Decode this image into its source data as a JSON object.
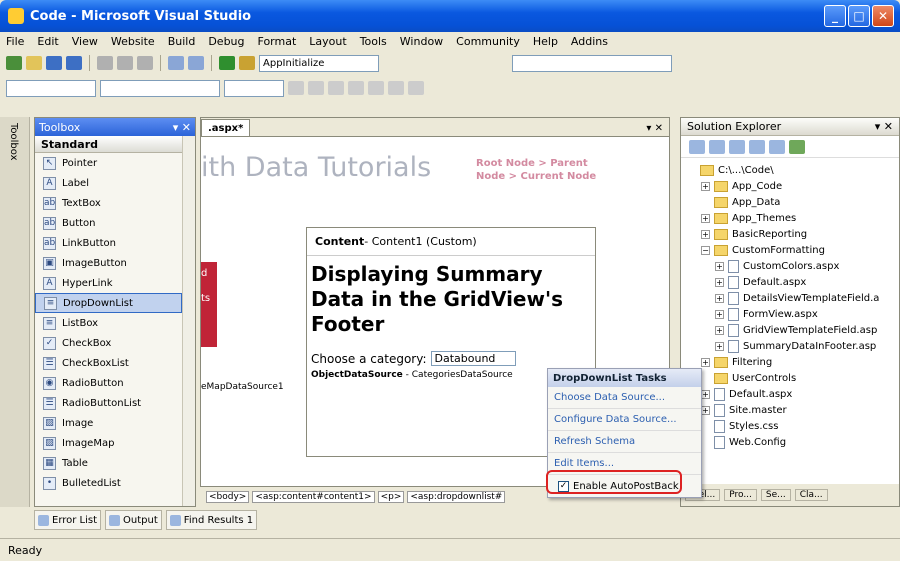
{
  "window": {
    "title": "Code - Microsoft Visual Studio",
    "controls": [
      "_",
      "□",
      "✕"
    ]
  },
  "menu": [
    "File",
    "Edit",
    "View",
    "Website",
    "Build",
    "Debug",
    "Format",
    "Layout",
    "Tools",
    "Window",
    "Community",
    "Help",
    "Addins"
  ],
  "toolbar": {
    "solution_combo": "AppInitialize"
  },
  "toolbox": {
    "title": "Toolbox",
    "section": "Standard",
    "items": [
      {
        "icon": "pointer-icon",
        "glyph": "↖",
        "label": "Pointer"
      },
      {
        "icon": "label-icon",
        "glyph": "A",
        "label": "Label"
      },
      {
        "icon": "textbox-icon",
        "glyph": "ab",
        "label": "TextBox"
      },
      {
        "icon": "button-icon",
        "glyph": "ab",
        "label": "Button"
      },
      {
        "icon": "linkbutton-icon",
        "glyph": "ab",
        "label": "LinkButton"
      },
      {
        "icon": "imagebutton-icon",
        "glyph": "▣",
        "label": "ImageButton"
      },
      {
        "icon": "hyperlink-icon",
        "glyph": "A",
        "label": "HyperLink"
      },
      {
        "icon": "dropdownlist-icon",
        "glyph": "≡",
        "label": "DropDownList"
      },
      {
        "icon": "listbox-icon",
        "glyph": "≡",
        "label": "ListBox"
      },
      {
        "icon": "checkbox-icon",
        "glyph": "✓",
        "label": "CheckBox"
      },
      {
        "icon": "checkboxlist-icon",
        "glyph": "☰",
        "label": "CheckBoxList"
      },
      {
        "icon": "radiobutton-icon",
        "glyph": "◉",
        "label": "RadioButton"
      },
      {
        "icon": "radiobuttonlist-icon",
        "glyph": "☰",
        "label": "RadioButtonList"
      },
      {
        "icon": "image-icon",
        "glyph": "▨",
        "label": "Image"
      },
      {
        "icon": "imagemap-icon",
        "glyph": "▨",
        "label": "ImageMap"
      },
      {
        "icon": "table-icon",
        "glyph": "▦",
        "label": "Table"
      },
      {
        "icon": "bulletedlist-icon",
        "glyph": "•",
        "label": "BulletedList"
      }
    ]
  },
  "editor": {
    "tab": ".aspx*",
    "heading": "ith Data Tutorials",
    "breadcrumb": "Root Node > Parent Node > Current Node",
    "content_label": "Content",
    "content_sub": " - Content1 (Custom)",
    "page_heading": "Displaying Summary Data in the GridView's Footer",
    "choose_label": "Choose a category:",
    "dropdown_value": "Databound",
    "objectds": "ObjectDataSource",
    "objectds_sub": " - CategoriesDataSource",
    "sitemap_ds": "eMapDataSource1",
    "left_red_1": "d",
    "left_red_2": "ts"
  },
  "tasks": {
    "title": "DropDownList Tasks",
    "items": [
      "Choose Data Source...",
      "Configure Data Source...",
      "Refresh Schema",
      "Edit Items..."
    ],
    "checkbox": "Enable AutoPostBack"
  },
  "crumbs": [
    "<body>",
    "<asp:content#content1>",
    "<p>",
    "<asp:dropdownlist#"
  ],
  "solution": {
    "title": "Solution Explorer",
    "tree": [
      {
        "t": "C:\\...\\Code\\",
        "type": "root",
        "exp": "",
        "indent": 0
      },
      {
        "t": "App_Code",
        "type": "fold",
        "exp": "+",
        "indent": 1
      },
      {
        "t": "App_Data",
        "type": "fold",
        "exp": "",
        "indent": 1
      },
      {
        "t": "App_Themes",
        "type": "fold",
        "exp": "+",
        "indent": 1
      },
      {
        "t": "BasicReporting",
        "type": "fold",
        "exp": "+",
        "indent": 1
      },
      {
        "t": "CustomFormatting",
        "type": "fold",
        "exp": "−",
        "indent": 1
      },
      {
        "t": "CustomColors.aspx",
        "type": "file",
        "exp": "+",
        "indent": 2
      },
      {
        "t": "Default.aspx",
        "type": "file",
        "exp": "+",
        "indent": 2
      },
      {
        "t": "DetailsViewTemplateField.a",
        "type": "file",
        "exp": "+",
        "indent": 2
      },
      {
        "t": "FormView.aspx",
        "type": "file",
        "exp": "+",
        "indent": 2
      },
      {
        "t": "GridViewTemplateField.asp",
        "type": "file",
        "exp": "+",
        "indent": 2
      },
      {
        "t": "SummaryDataInFooter.asp",
        "type": "file",
        "exp": "+",
        "indent": 2
      },
      {
        "t": "Filtering",
        "type": "fold",
        "exp": "+",
        "indent": 1
      },
      {
        "t": "UserControls",
        "type": "fold",
        "exp": "",
        "indent": 1
      },
      {
        "t": "Default.aspx",
        "type": "file",
        "exp": "+",
        "indent": 1
      },
      {
        "t": "Site.master",
        "type": "file",
        "exp": "+",
        "indent": 1
      },
      {
        "t": "Styles.css",
        "type": "file",
        "exp": "",
        "indent": 1
      },
      {
        "t": "Web.Config",
        "type": "file",
        "exp": "",
        "indent": 1
      }
    ],
    "bottom_tabs": [
      "...el...",
      "Pro...",
      "Se...",
      "Cla..."
    ]
  },
  "bottom": {
    "tabs": [
      "Error List",
      "Output",
      "Find Results 1"
    ]
  },
  "side_tab": "Toolbox",
  "status": "Ready"
}
